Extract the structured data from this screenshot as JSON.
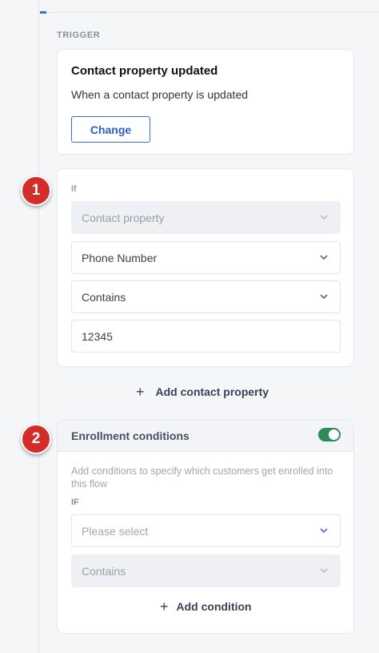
{
  "trigger": {
    "section_label": "TRIGGER",
    "title": "Contact property updated",
    "description": "When a contact property is updated",
    "change_label": "Change"
  },
  "if_block": {
    "label": "If",
    "fields": [
      {
        "value": "Contact property",
        "disabled": true,
        "type": "select"
      },
      {
        "value": "Phone Number",
        "disabled": false,
        "type": "select"
      },
      {
        "value": "Contains",
        "disabled": false,
        "type": "select"
      },
      {
        "value": "12345",
        "disabled": false,
        "type": "text"
      }
    ],
    "add_label": "Add contact property"
  },
  "enrollment": {
    "title": "Enrollment conditions",
    "toggle_on": true,
    "description": "Add conditions to specify which customers get enrolled into this flow",
    "if_label": "IF",
    "select_placeholder": "Please select",
    "operator": "Contains",
    "add_label": "Add condition"
  },
  "callouts": [
    "1",
    "2"
  ],
  "colors": {
    "accent": "#3a6fd8",
    "toggle": "#2e8b57",
    "callout": "#d42b2b"
  }
}
